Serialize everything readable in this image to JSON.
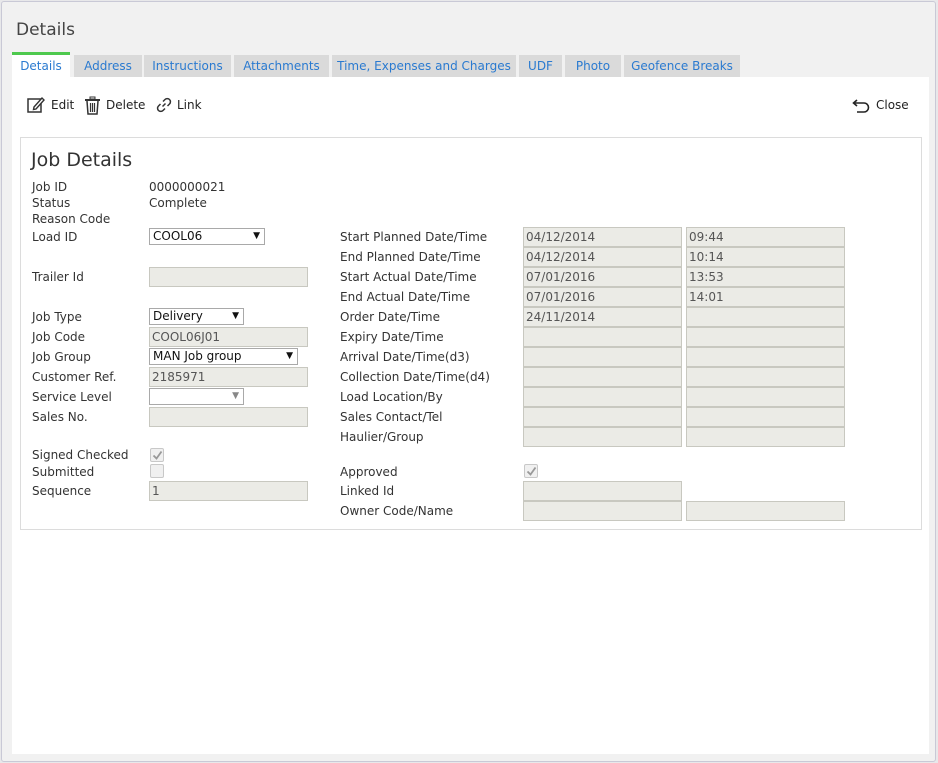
{
  "window": {
    "title": "Details"
  },
  "tabs": [
    {
      "label": "Details"
    },
    {
      "label": "Address"
    },
    {
      "label": "Instructions"
    },
    {
      "label": "Attachments"
    },
    {
      "label": "Time, Expenses and Charges"
    },
    {
      "label": "UDF"
    },
    {
      "label": "Photo"
    },
    {
      "label": "Geofence Breaks"
    }
  ],
  "toolbar": {
    "edit_label": "Edit",
    "delete_label": "Delete",
    "link_label": "Link",
    "close_label": "Close"
  },
  "panel": {
    "title": "Job Details",
    "job_id": {
      "label": "Job ID",
      "value": "0000000021"
    },
    "status": {
      "label": "Status",
      "value": "Complete"
    },
    "reason_code": {
      "label": "Reason Code",
      "value": ""
    },
    "load_id": {
      "label": "Load ID",
      "value": "COOL06"
    },
    "trailer_id": {
      "label": "Trailer Id",
      "value": ""
    },
    "job_type": {
      "label": "Job Type",
      "value": "Delivery"
    },
    "job_code": {
      "label": "Job Code",
      "value": "COOL06J01"
    },
    "job_group": {
      "label": "Job Group",
      "value": "MAN Job group"
    },
    "customer_ref": {
      "label": "Customer Ref.",
      "value": "2185971"
    },
    "service_level": {
      "label": "Service Level",
      "value": ""
    },
    "sales_no": {
      "label": "Sales No.",
      "value": ""
    },
    "signed_checked": {
      "label": "Signed Checked",
      "checked": true
    },
    "submitted": {
      "label": "Submitted",
      "checked": false
    },
    "sequence": {
      "label": "Sequence",
      "value": "1"
    },
    "start_planned": {
      "label": "Start Planned Date/Time",
      "date": "04/12/2014",
      "time": "09:44"
    },
    "end_planned": {
      "label": "End Planned Date/Time",
      "date": "04/12/2014",
      "time": "10:14"
    },
    "start_actual": {
      "label": "Start Actual Date/Time",
      "date": "07/01/2016",
      "time": "13:53"
    },
    "end_actual": {
      "label": "End Actual Date/Time",
      "date": "07/01/2016",
      "time": "14:01"
    },
    "order_date": {
      "label": "Order Date/Time",
      "date": "24/11/2014",
      "time": ""
    },
    "expiry_date": {
      "label": "Expiry Date/Time",
      "date": "",
      "time": ""
    },
    "arrival_date": {
      "label": "Arrival Date/Time(d3)",
      "date": "",
      "time": ""
    },
    "collection_date": {
      "label": "Collection Date/Time(d4)",
      "date": "",
      "time": ""
    },
    "load_location": {
      "label": "Load Location/By",
      "a": "",
      "b": ""
    },
    "sales_contact": {
      "label": "Sales Contact/Tel",
      "a": "",
      "b": ""
    },
    "haulier": {
      "label": "Haulier/Group",
      "a": "",
      "b": ""
    },
    "approved": {
      "label": "Approved",
      "checked": true
    },
    "linked_id": {
      "label": "Linked Id",
      "value": ""
    },
    "owner_code": {
      "label": "Owner Code/Name",
      "a": "",
      "b": ""
    }
  }
}
